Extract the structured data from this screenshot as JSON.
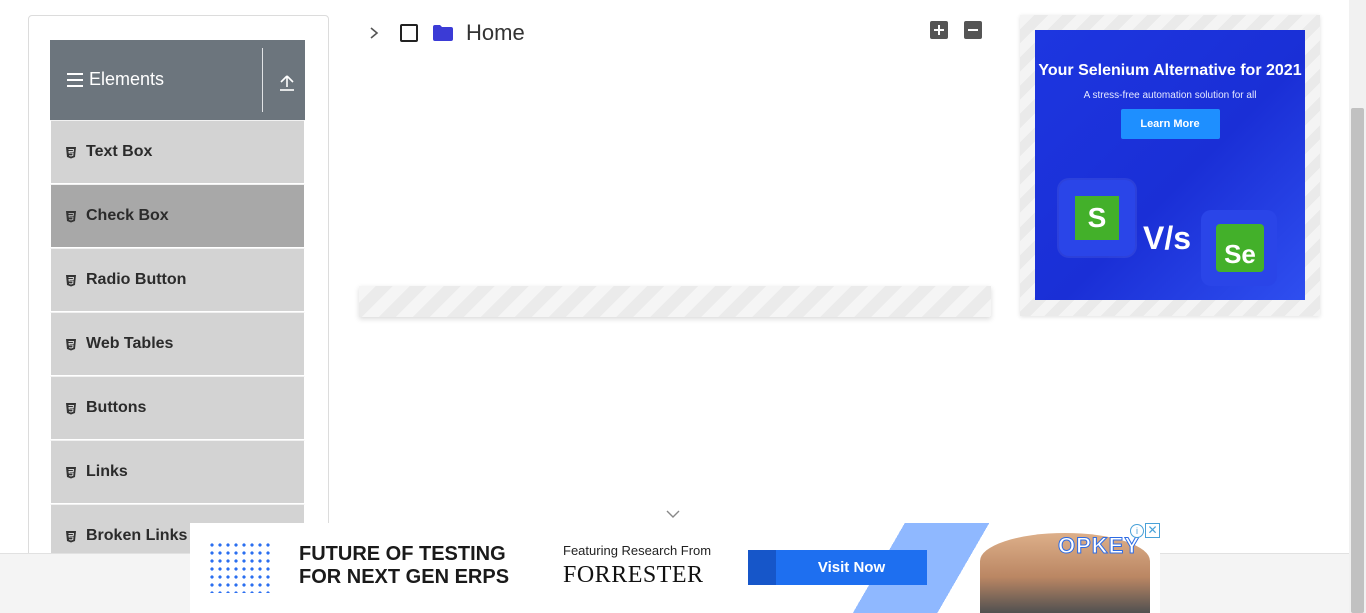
{
  "sidebar": {
    "group_title": "Elements",
    "items": [
      {
        "label": "Text Box"
      },
      {
        "label": "Check Box"
      },
      {
        "label": "Radio Button"
      },
      {
        "label": "Web Tables"
      },
      {
        "label": "Buttons"
      },
      {
        "label": "Links"
      },
      {
        "label": "Broken Links -"
      }
    ],
    "active_item": "Check Box"
  },
  "tree": {
    "node_label": "Home",
    "expand_all": "plus-square-icon",
    "collapse_all": "minus-square-icon"
  },
  "right_ad": {
    "headline": "Your Selenium Alternative for 2021",
    "subhead": "A stress-free automation solution for all",
    "button": "Learn More",
    "vs_text": "V/s",
    "logo_left": "S",
    "logo_right": "Se"
  },
  "bottom_ad": {
    "headline_line1": "FUTURE OF TESTING",
    "headline_line2": "FOR NEXT GEN ERPS",
    "featuring": "Featuring Research From",
    "brand": "FORRESTER",
    "button": "Visit Now",
    "logo": "OPKEY",
    "info": "i",
    "close": "✕"
  },
  "colors": {
    "sidebar_header": "#6c757d",
    "menu_item": "#d3d3d3",
    "menu_item_active": "#a8a8a8",
    "folder": "#3b3bd6",
    "ad_blue": "#1a2fd6",
    "cta_blue": "#1e6ff0"
  }
}
